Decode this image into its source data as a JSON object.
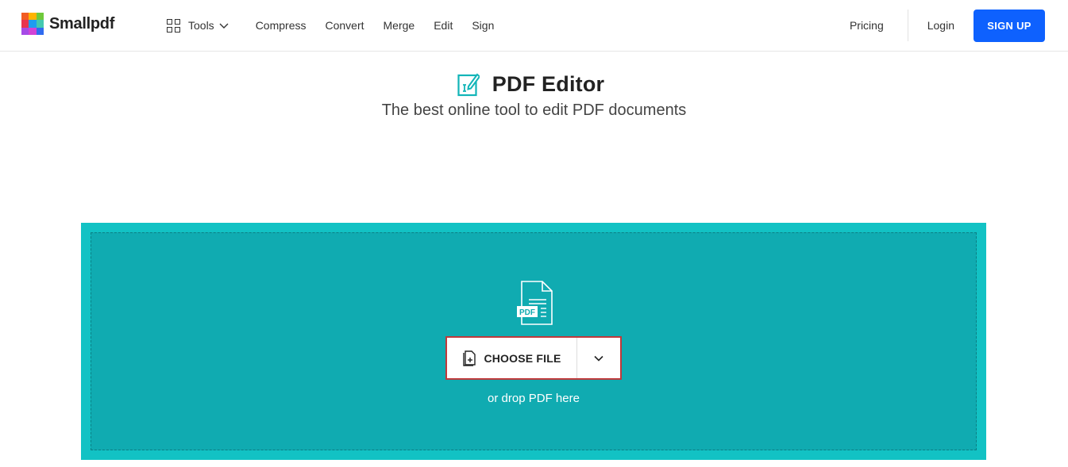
{
  "brand": {
    "name": "Smallpdf",
    "logo_colors": [
      "#f25c22",
      "#ffb400",
      "#6fc93b",
      "#e8344f",
      "#1e9cf0",
      "#43c8b0",
      "#a64ae6",
      "#d143d6",
      "#2f6bf0"
    ]
  },
  "nav": {
    "tools_label": "Tools",
    "links": [
      "Compress",
      "Convert",
      "Merge",
      "Edit",
      "Sign"
    ]
  },
  "header_right": {
    "pricing": "Pricing",
    "login": "Login",
    "signup": "SIGN UP"
  },
  "hero": {
    "title": "PDF Editor",
    "subtitle": "The best online tool to edit PDF documents",
    "icon": "pdf-edit-icon"
  },
  "dropzone": {
    "choose_label": "CHOOSE FILE",
    "hint": "or drop PDF here",
    "pdf_badge": "PDF"
  },
  "colors": {
    "accent_teal": "#12c2c4",
    "dropzone_inner": "#10abb1",
    "signup_blue": "#0e61fe",
    "highlight_border": "#c0393b"
  }
}
